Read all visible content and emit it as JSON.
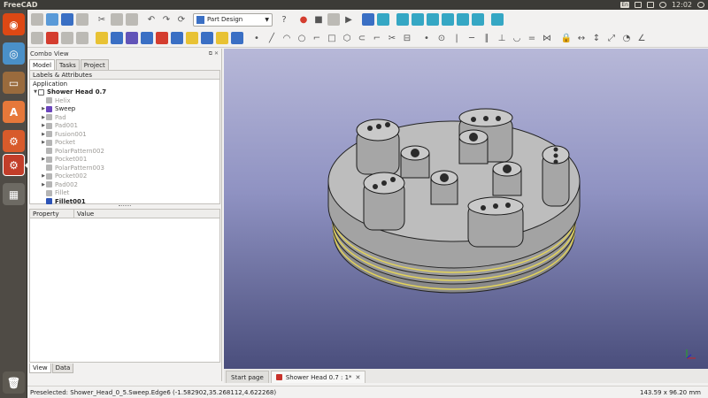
{
  "top_panel": {
    "app_title": "FreeCAD",
    "keyboard": "En",
    "clock": "12:02"
  },
  "launcher": {
    "items": [
      "ubuntu-icon",
      "chromium-icon",
      "files-icon",
      "software-center-icon",
      "system-settings-icon",
      "freecad-icon",
      "calculator-icon",
      "trash-icon"
    ]
  },
  "toolbar": {
    "workbench_selected": "Part Design"
  },
  "combo_view": {
    "title": "Combo View",
    "tabs": [
      "Model",
      "Tasks",
      "Project"
    ],
    "labels_header": "Labels & Attributes",
    "tree_root": "Application",
    "document": "Shower Head 0.7",
    "items": [
      {
        "label": "Helix",
        "icon": "helix-icon",
        "dimmed": true,
        "expandable": false
      },
      {
        "label": "Sweep",
        "icon": "sweep-icon",
        "dimmed": false,
        "expandable": true
      },
      {
        "label": "Pad",
        "icon": "pad-icon",
        "dimmed": true,
        "expandable": true
      },
      {
        "label": "Pad001",
        "icon": "pad-icon",
        "dimmed": true,
        "expandable": true
      },
      {
        "label": "Fusion001",
        "icon": "fusion-icon",
        "dimmed": true,
        "expandable": true
      },
      {
        "label": "Pocket",
        "icon": "pocket-icon",
        "dimmed": true,
        "expandable": true
      },
      {
        "label": "PolarPattern002",
        "icon": "polar-pattern-icon",
        "dimmed": true,
        "expandable": false
      },
      {
        "label": "Pocket001",
        "icon": "pocket-icon",
        "dimmed": true,
        "expandable": true
      },
      {
        "label": "PolarPattern003",
        "icon": "polar-pattern-icon",
        "dimmed": true,
        "expandable": false
      },
      {
        "label": "Pocket002",
        "icon": "pocket-icon",
        "dimmed": true,
        "expandable": true
      },
      {
        "label": "Pad002",
        "icon": "pad-icon",
        "dimmed": true,
        "expandable": true
      },
      {
        "label": "Fillet",
        "icon": "fillet-icon",
        "dimmed": true,
        "expandable": false
      },
      {
        "label": "Fillet001",
        "icon": "fillet-icon",
        "dimmed": false,
        "expandable": false
      }
    ],
    "property_header": "Property",
    "value_header": "Value",
    "bottom_tabs": [
      "View",
      "Data"
    ]
  },
  "document_tabs": [
    {
      "label": "Start page",
      "active": false
    },
    {
      "label": "Shower Head 0.7 : 1*",
      "active": true
    }
  ],
  "status_bar": {
    "preselected": "Preselected: Shower_Head_0_5.Sweep.Edge6 (-1.582902,35.268112,4.622268)",
    "dimensions": "143.59 x 96.20 mm"
  },
  "colors": {
    "model_grey": "#a9a9a9",
    "edge_highlight": "#e3d35a",
    "background_top": "#b7b8d8",
    "background_bottom": "#4a4e7c"
  }
}
